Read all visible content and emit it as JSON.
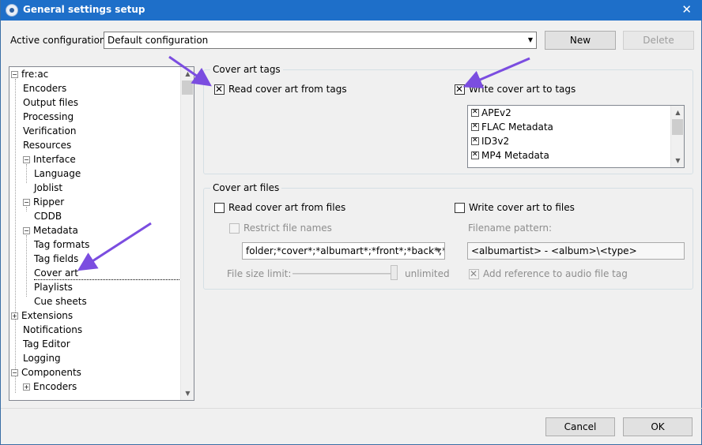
{
  "window": {
    "title": "General settings setup"
  },
  "config": {
    "label": "Active configuration:",
    "value": "Default configuration",
    "new_label": "New",
    "delete_label": "Delete"
  },
  "tree": {
    "items": [
      "fre:ac",
      "Encoders",
      "Output files",
      "Processing",
      "Verification",
      "Resources",
      "Interface",
      "Language",
      "Joblist",
      "Ripper",
      "CDDB",
      "Metadata",
      "Tag formats",
      "Tag fields",
      "Cover art",
      "Playlists",
      "Cue sheets",
      "Extensions",
      "Notifications",
      "Tag Editor",
      "Logging",
      "Components",
      "Encoders"
    ]
  },
  "cover_tags": {
    "title": "Cover art tags",
    "read_label": "Read cover art from tags",
    "write_label": "Write cover art to tags",
    "formats": [
      "APEv2",
      "FLAC Metadata",
      "ID3v2",
      "MP4 Metadata"
    ]
  },
  "cover_files": {
    "title": "Cover art files",
    "read_label": "Read cover art from files",
    "write_label": "Write cover art to files",
    "restrict_label": "Restrict file names",
    "restrict_value": "folder;*cover*;*albumart*;*front*;*back*;*ins",
    "pattern_label": "Filename pattern:",
    "pattern_value": "<albumartist> - <album>\\<type>",
    "size_label": "File size limit:",
    "size_value": "unlimited",
    "reference_label": "Add reference to audio file tag"
  },
  "footer": {
    "cancel_label": "Cancel",
    "ok_label": "OK"
  },
  "colors": {
    "titlebar": "#1e6fc9",
    "arrow": "#7b4de0"
  }
}
